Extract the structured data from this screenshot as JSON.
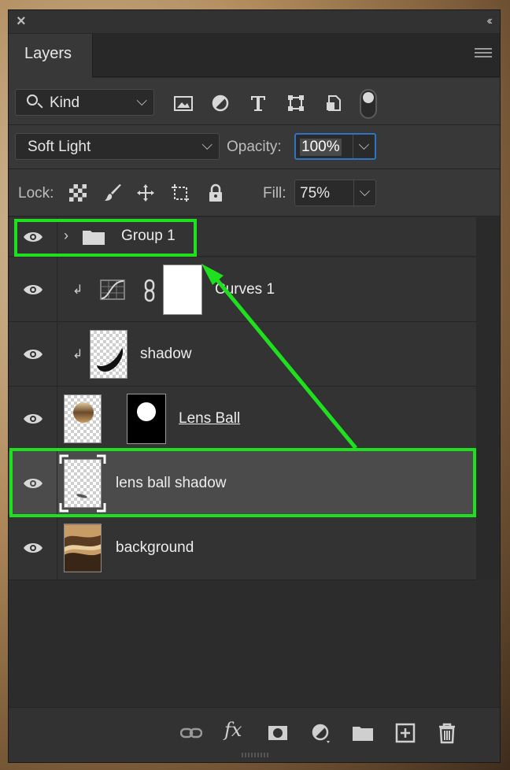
{
  "panel": {
    "tab_label": "Layers",
    "close_glyph": "×",
    "collapse_glyph": "‹‹"
  },
  "filter": {
    "kind_label": "Kind",
    "icons": [
      "image-filter-icon",
      "adjustment-filter-icon",
      "type-filter-icon",
      "shape-filter-icon",
      "smart-object-filter-icon",
      "filter-toggle"
    ]
  },
  "blend": {
    "mode": "Soft Light",
    "opacity_label": "Opacity:",
    "opacity_value": "100%"
  },
  "lock": {
    "label": "Lock:",
    "icons": [
      "lock-transparent-pixels-icon",
      "lock-image-pixels-icon",
      "lock-position-icon",
      "lock-artboard-icon",
      "lock-all-icon"
    ],
    "fill_label": "Fill:",
    "fill_value": "75%"
  },
  "layers": [
    {
      "name": "Group 1",
      "type": "group"
    },
    {
      "name": "Curves 1",
      "type": "adjustment",
      "clipped": true
    },
    {
      "name": "shadow",
      "type": "pixel",
      "clipped": true
    },
    {
      "name": "Lens Ball",
      "type": "pixel-with-mask"
    },
    {
      "name": "lens ball shadow",
      "type": "pixel",
      "selected": true
    },
    {
      "name": "background",
      "type": "pixel"
    }
  ],
  "bottom_bar": {
    "fx_label": "fx",
    "icons": [
      "link-layers-icon",
      "fx-icon",
      "add-mask-icon",
      "adjustment-layer-icon",
      "new-group-icon",
      "new-layer-icon",
      "delete-layer-icon"
    ]
  },
  "colors": {
    "highlight": "#1ee01e",
    "selected_row": "#4b4b4b",
    "focus_border": "#2d74c4"
  }
}
